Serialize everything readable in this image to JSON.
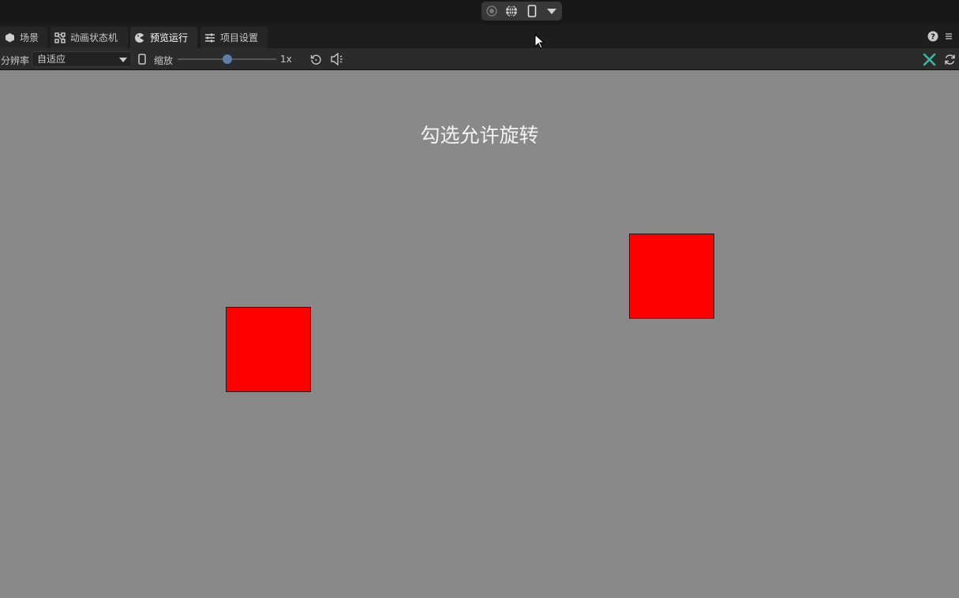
{
  "tabs": [
    {
      "label": "场景",
      "icon": "scene-icon"
    },
    {
      "label": "动画状态机",
      "icon": "state-machine-icon"
    },
    {
      "label": "预览运行",
      "icon": "preview-icon"
    },
    {
      "label": "项目设置",
      "icon": "settings-sliders-icon"
    }
  ],
  "toolbar": {
    "resolution_label": "分辨率",
    "resolution_value": "自适应",
    "zoom_label": "缩放",
    "zoom_value_text": "1x",
    "zoom_level_fraction": 0.5
  },
  "stage": {
    "title": "勾选允许旋转"
  },
  "colors": {
    "box_fill": "#ff0000",
    "stage_bg": "#898989",
    "accent_green": "#2fbf9f"
  }
}
